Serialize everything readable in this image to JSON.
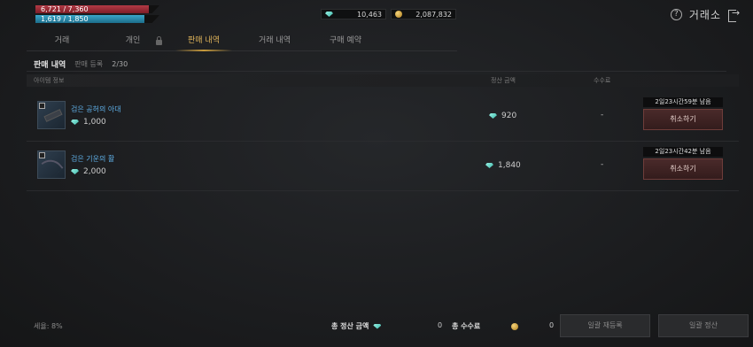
{
  "status": {
    "hp": "6,721 / 7,360",
    "mp": "1,619 / 1,850",
    "hp_ratio": 0.913,
    "mp_ratio": 0.875
  },
  "currency": {
    "gem_amount": "10,463",
    "gold_amount": "2,087,832"
  },
  "header": {
    "title": "거래소",
    "help_icon": "?"
  },
  "tabs": [
    "거래",
    "개인",
    "판매 내역",
    "거래 내역",
    "구매 예약"
  ],
  "section": {
    "title": "판매 내역",
    "subtitle": "판매 등록",
    "count": "2/30"
  },
  "columns": {
    "item_info": "아이템 정보",
    "settle_amount": "정산 금액",
    "fee": "수수료"
  },
  "rows": [
    {
      "name": "검은 공허의 아대",
      "price": "1,000",
      "settle": "920",
      "fee": "-",
      "timer": "2일23시간59분 남음",
      "cancel": "취소하기"
    },
    {
      "name": "검은 기운의 활",
      "price": "2,000",
      "settle": "1,840",
      "fee": "-",
      "timer": "2일23시간42분 남음",
      "cancel": "취소하기"
    }
  ],
  "footer": {
    "tax": "세율: 8%",
    "total_settle_label": "총 정산 금액",
    "total_settle_value": "0",
    "total_fee_label": "총 수수료",
    "total_fee_value": "0",
    "reregister": "일괄 재등록",
    "settle_all": "일괄 정산"
  }
}
